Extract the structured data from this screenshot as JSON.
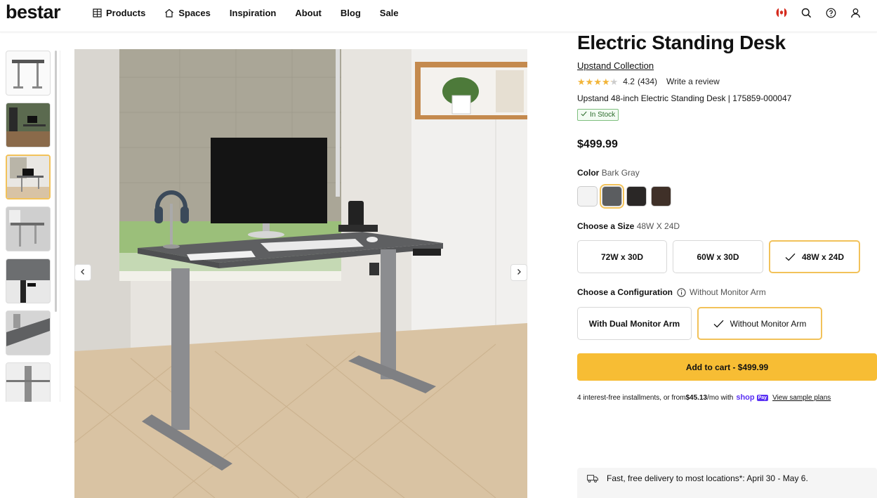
{
  "header": {
    "logo": "bestar",
    "nav": [
      {
        "label": "Products",
        "icon": "grid-menu-icon"
      },
      {
        "label": "Spaces",
        "icon": "home-icon"
      },
      {
        "label": "Inspiration"
      },
      {
        "label": "About"
      },
      {
        "label": "Blog"
      },
      {
        "label": "Sale"
      }
    ],
    "icons": [
      "canada-flag-icon",
      "search-icon",
      "help-icon",
      "account-icon"
    ]
  },
  "gallery": {
    "thumb_count": 7,
    "active_index": 2
  },
  "product": {
    "title": "Electric Standing Desk",
    "collection": "Upstand Collection",
    "rating": "4.2",
    "reviews": "(434)",
    "write_review": "Write a review",
    "rating_value": 4.2,
    "sku_line": "Upstand 48-inch Electric Standing Desk | 175859-000047",
    "stock": "In Stock",
    "price": "$499.99",
    "color_label": "Color",
    "color_value": "Bark Gray",
    "swatches": [
      {
        "name": "white",
        "color": "#f3f3f3"
      },
      {
        "name": "bark-gray",
        "color": "#5b5d60"
      },
      {
        "name": "black",
        "color": "#2a2726"
      },
      {
        "name": "dark-brown",
        "color": "#3f3028"
      }
    ],
    "size_label": "Choose a Size",
    "size_value": "48W X 24D",
    "sizes": [
      "72W x 30D",
      "60W x 30D",
      "48W x 24D"
    ],
    "config_label": "Choose a Configuration",
    "config_value": "Without Monitor Arm",
    "configs": [
      "With Dual Monitor Arm",
      "Without Monitor Arm"
    ],
    "cart_button": "Add to cart - $499.99",
    "install_prefix": "4 interest-free installments, or from ",
    "install_amount": "$45.13",
    "install_suffix": "/mo with",
    "shop_brand": "shop",
    "shop_pay": "Pay",
    "install_link": "View sample plans",
    "delivery": "Fast, free delivery to most locations*: April 30 - May 6."
  },
  "colors": {
    "accent": "#f7bd34",
    "selected_border": "#f2c25a",
    "shop_purple": "#5a31f4"
  }
}
